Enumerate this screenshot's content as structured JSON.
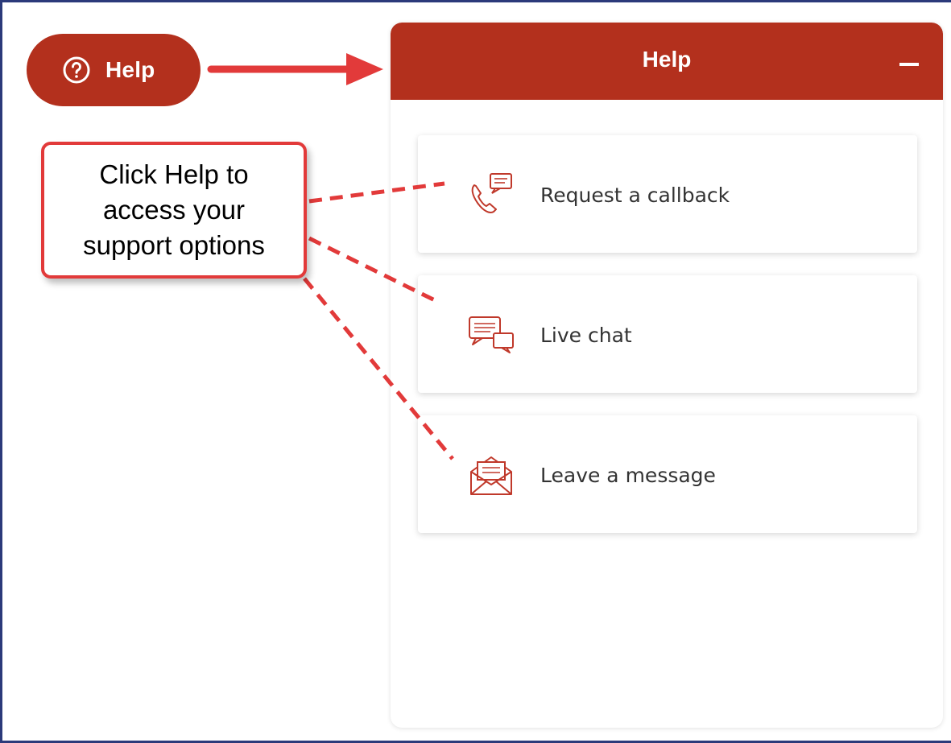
{
  "help_button": {
    "label": "Help",
    "icon": "question-circle-icon"
  },
  "panel": {
    "title": "Help",
    "minimize_icon": "minus-icon",
    "options": [
      {
        "label": "Request a callback",
        "icon": "phone-callback-icon"
      },
      {
        "label": "Live chat",
        "icon": "chat-bubbles-icon"
      },
      {
        "label": "Leave a message",
        "icon": "envelope-icon"
      }
    ]
  },
  "annotation": {
    "text": "Click Help to access your support options"
  },
  "colors": {
    "brand": "#b3301d",
    "annotation": "#e23a3a",
    "frame": "#2b3a7a"
  }
}
